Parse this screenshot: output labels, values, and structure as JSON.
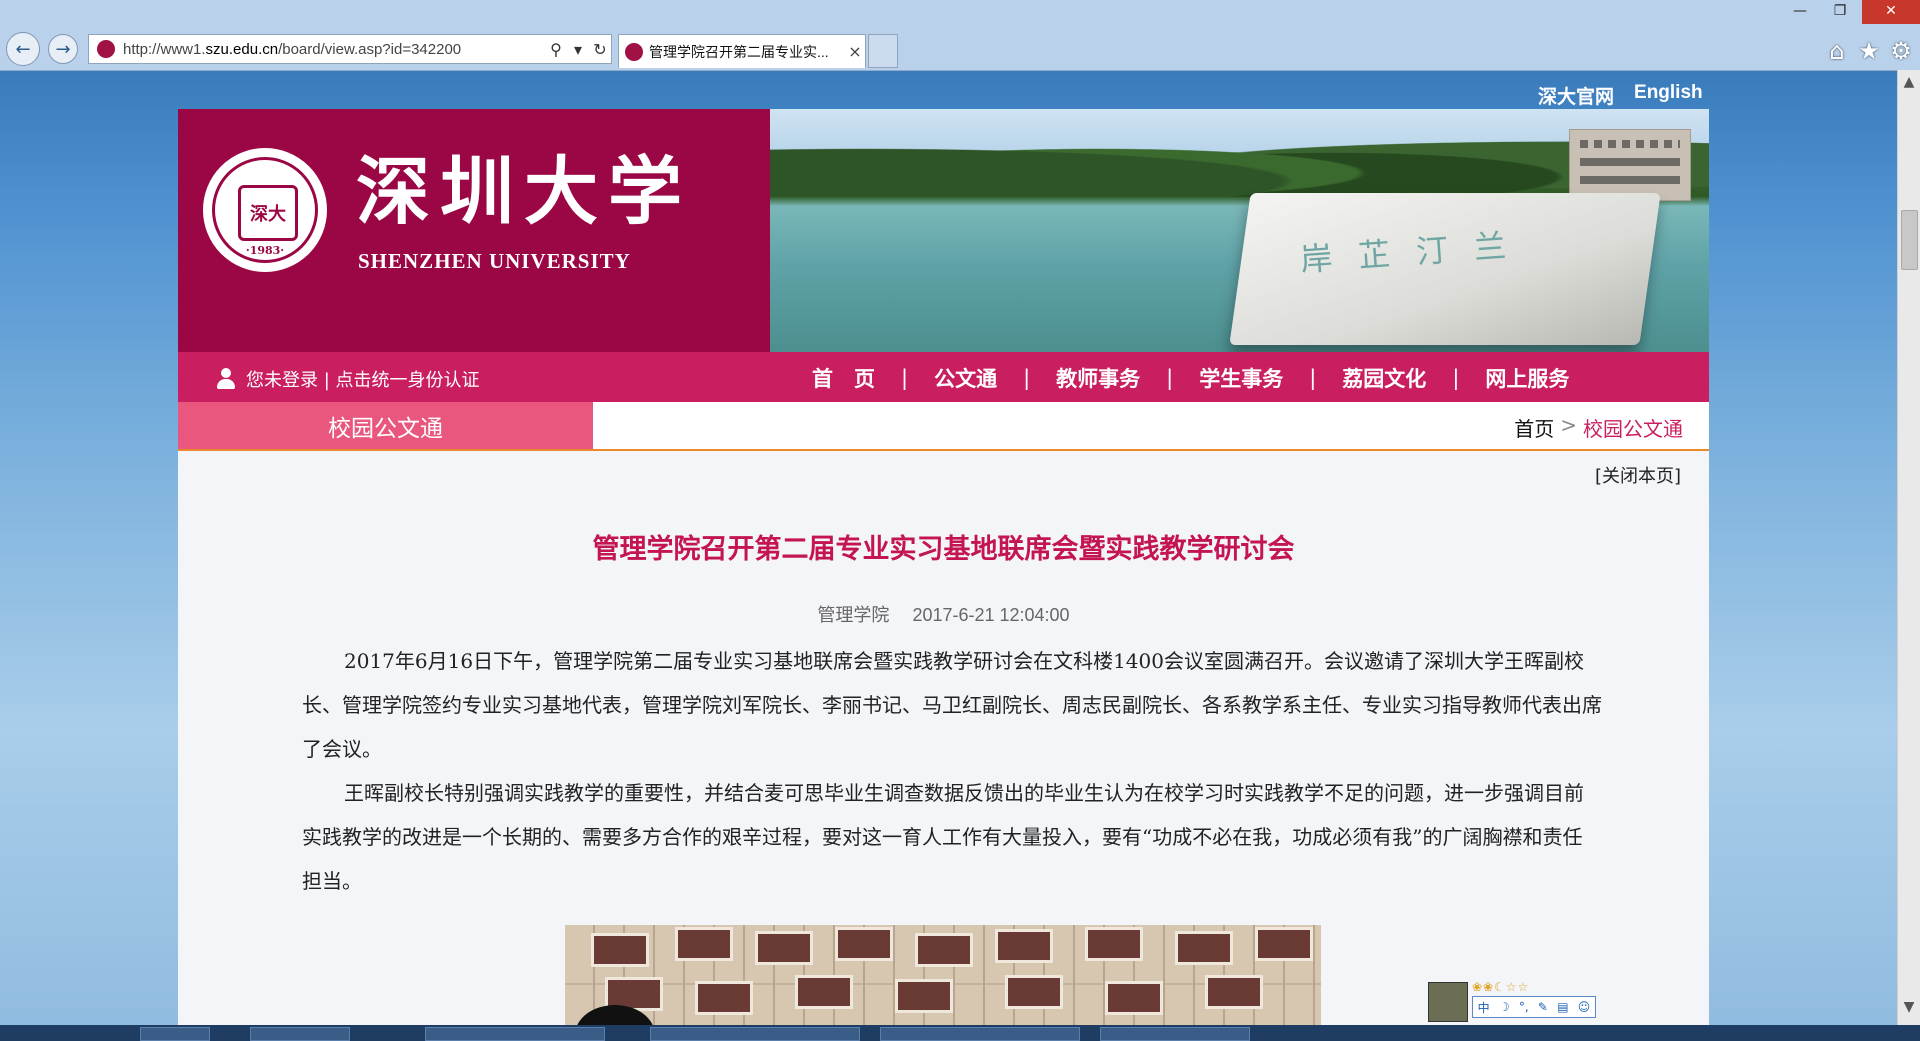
{
  "browser": {
    "url_prefix": "http://www1.",
    "url_domain": "szu.edu.cn",
    "url_path": "/board/view.asp?id=342200",
    "tab_title": "管理学院召开第二届专业实...",
    "tab_close": "×",
    "window_min": "—",
    "window_restore": "❐",
    "window_close": "✕"
  },
  "site": {
    "top_links": [
      "深大官网",
      "English"
    ],
    "logo_cn": "深圳大学",
    "logo_en": "SHENZHEN UNIVERSITY",
    "seal_inner": "深大",
    "seal_year": "·1983·",
    "rock_text": "岸芷汀兰"
  },
  "nav": {
    "login_text": "您未登录 | 点击统一身份认证",
    "items": [
      "首　页",
      "公文通",
      "教师事务",
      "学生事务",
      "荔园文化",
      "网上服务"
    ],
    "separator": "|"
  },
  "subbar": {
    "section": "校园公文通",
    "crumb_home": "首页",
    "crumb_arrow": ">",
    "crumb_current": "校园公文通"
  },
  "article": {
    "close_link": "[关闭本页]",
    "title": "管理学院召开第二届专业实习基地联席会暨实践教学研讨会",
    "department": "管理学院",
    "datetime": "2017-6-21 12:04:00",
    "paragraphs": [
      "2017年6月16日下午，管理学院第二届专业实习基地联席会暨实践教学研讨会在文科楼1400会议室圆满召开。会议邀请了深圳大学王晖副校长、管理学院签约专业实习基地代表，管理学院刘军院长、李丽书记、马卫红副院长、周志民副院长、各系教学系主任、专业实习指导教师代表出席了会议。",
      "王晖副校长特别强调实践教学的重要性，并结合麦可思毕业生调查数据反馈出的毕业生认为在校学习时实践教学不足的问题，进一步强调目前实践教学的改进是一个长期的、需要多方合作的艰辛过程，要对这一育人工作有大量投入，要有“功成不必在我，功成必须有我”的广阔胸襟和责任担当。"
    ]
  },
  "ime": {
    "stars": "❀❀☾☆☆",
    "items": [
      "中",
      "☽",
      "°,",
      "✎",
      "▤",
      "☺"
    ]
  },
  "colors": {
    "brand": "#9b0744",
    "nav": "#c91f60",
    "section": "#e9577f",
    "title": "#c41454",
    "accent_line": "#e8892c"
  }
}
